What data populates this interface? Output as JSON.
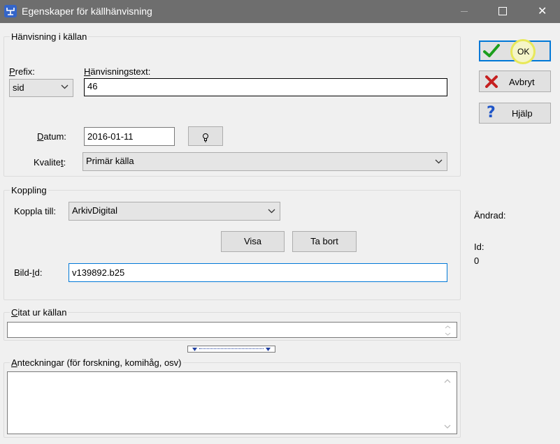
{
  "window": {
    "title": "Egenskaper för källhänvisning",
    "close_glyph": "✕"
  },
  "reference_group": {
    "title": "Hänvisning i källan",
    "prefix_label_u": "P",
    "prefix_label_rest": "refix:",
    "prefix_value": "sid",
    "text_label_u": "H",
    "text_label_rest": "änvisningstext:",
    "text_value": "46",
    "date_label_u": "D",
    "date_label_rest": "atum:",
    "date_value": "2016-01-11",
    "quality_label_pre": "Kvalite",
    "quality_label_u": "t",
    "quality_label_post": ":",
    "quality_value": "Primär källa"
  },
  "link_group": {
    "title": "Koppling",
    "link_label": "Koppla till:",
    "link_value": "ArkivDigital",
    "show_button": "Visa",
    "remove_button": "Ta bort",
    "image_id_label_pre": "Bild-",
    "image_id_label_u": "I",
    "image_id_label_post": "d:",
    "image_id_value": "v139892.b25"
  },
  "quote_group": {
    "title_u": "C",
    "title_rest": "itat ur källan",
    "value": ""
  },
  "notes_group": {
    "title_u": "A",
    "title_rest": "nteckningar (för forskning, komihåg, osv)",
    "value": ""
  },
  "side": {
    "ok_label": "OK",
    "cancel_label": "Avbryt",
    "help_label": "Hjälp",
    "help_glyph": "?",
    "changed_label": "Ändrad:",
    "id_label": "Id:",
    "id_value": "0"
  },
  "colors": {
    "titlebar": "#6e6e6e",
    "check_green": "#1b9e1b",
    "cancel_red": "#c62020",
    "help_blue": "#1f55c8",
    "focus_border": "#0078d7",
    "highlight_ring": "#e8e85a"
  },
  "icons": {
    "app": "family-tree-icon",
    "date_picker": "lightbulb-icon",
    "ok": "checkmark-icon",
    "cancel": "red-x-icon",
    "help": "question-mark-icon"
  }
}
